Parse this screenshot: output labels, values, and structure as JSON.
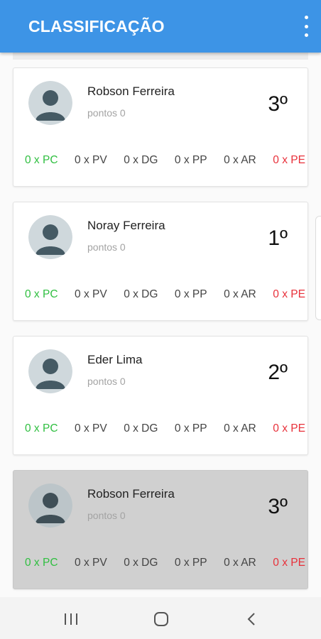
{
  "appbar": {
    "title": "CLASSIFICAÇÃO",
    "menu_icon": "more-vertical-icon"
  },
  "cards": [
    {
      "name": "Robson Ferreira",
      "points": "pontos 0",
      "rank": "3º",
      "stats": {
        "pc": "0 x PC",
        "pv": "0 x PV",
        "dg": "0 x DG",
        "pp": "0 x PP",
        "ar": "0 x AR",
        "pe": "0 x PE"
      }
    },
    {
      "name": "Noray Ferreira",
      "points": "pontos 0",
      "rank": "1º",
      "stats": {
        "pc": "0 x PC",
        "pv": "0 x PV",
        "dg": "0 x DG",
        "pp": "0 x PP",
        "ar": "0 x AR",
        "pe": "0 x PE"
      }
    },
    {
      "name": "Eder Lima",
      "points": "pontos 0",
      "rank": "2º",
      "stats": {
        "pc": "0 x PC",
        "pv": "0 x PV",
        "dg": "0 x DG",
        "pp": "0 x PP",
        "ar": "0 x AR",
        "pe": "0 x PE"
      }
    },
    {
      "name": "Robson Ferreira",
      "points": "pontos 0",
      "rank": "3º",
      "stats": {
        "pc": "0 x PC",
        "pv": "0 x PV",
        "dg": "0 x DG",
        "pp": "0 x PP",
        "ar": "0 x AR",
        "pe": "0 x PE"
      }
    }
  ],
  "colors": {
    "primary": "#3d94e6",
    "positive": "#2fbf40",
    "negative": "#e8303a",
    "selected_card": "#d0d0d0"
  },
  "navbar": {
    "icons": [
      "recent-apps-icon",
      "home-icon",
      "back-icon"
    ]
  }
}
